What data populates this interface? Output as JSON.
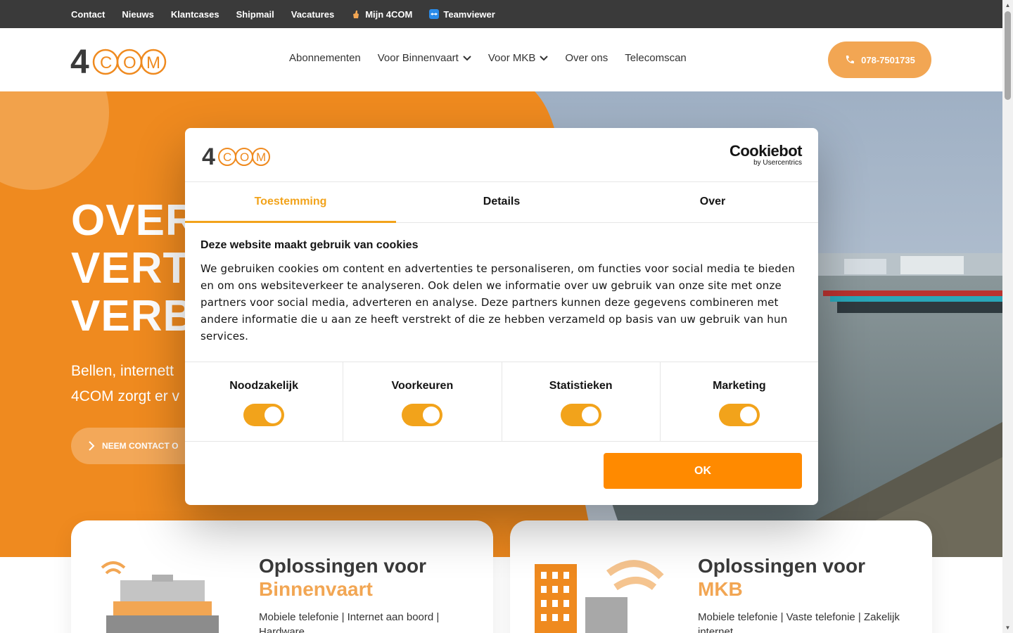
{
  "topbar": {
    "links": [
      "Contact",
      "Nieuws",
      "Klantcases",
      "Shipmail",
      "Vacatures"
    ],
    "mijn": "Mijn 4COM",
    "teamviewer": "Teamviewer"
  },
  "header": {
    "logo_text": "4COM",
    "nav": [
      "Abonnementen",
      "Voor Binnenvaart",
      "Voor MKB",
      "Over ons",
      "Telecomscan"
    ],
    "phone": "078-7501735"
  },
  "hero": {
    "title_lines": [
      "OVER",
      "VERT",
      "VERB"
    ],
    "sub_lines": [
      "Bellen, internett",
      "4COM zorgt er v"
    ],
    "button": "NEEM CONTACT O"
  },
  "cards": [
    {
      "title": "Oplossingen voor",
      "accent": "Binnenvaart",
      "desc": "Mobiele telefonie | Internet aan boord | Hardware"
    },
    {
      "title": "Oplossingen voor",
      "accent": "MKB",
      "desc": "Mobiele telefonie | Vaste telefonie | Zakelijk internet"
    }
  ],
  "cookie": {
    "brand": "Cookiebot",
    "brand_sub": "by Usercentrics",
    "tabs": [
      "Toestemming",
      "Details",
      "Over"
    ],
    "heading": "Deze website maakt gebruik van cookies",
    "text": "We gebruiken cookies om content en advertenties te personaliseren, om functies voor social media te bieden en om ons websiteverkeer te analyseren. Ook delen we informatie over uw gebruik van onze site met onze partners voor social media, adverteren en analyse. Deze partners kunnen deze gegevens combineren met andere informatie die u aan ze heeft verstrekt of die ze hebben verzameld op basis van uw gebruik van hun services.",
    "toggles": [
      {
        "label": "Noodzakelijk",
        "on": true
      },
      {
        "label": "Voorkeuren",
        "on": true
      },
      {
        "label": "Statistieken",
        "on": true
      },
      {
        "label": "Marketing",
        "on": true
      }
    ],
    "ok": "OK"
  },
  "colors": {
    "brand_orange": "#ef8a1f",
    "light_orange": "#f2a653",
    "cookie_accent": "#f2a31b",
    "ok_button": "#ff8a00",
    "topbar": "#3a3a3a"
  }
}
